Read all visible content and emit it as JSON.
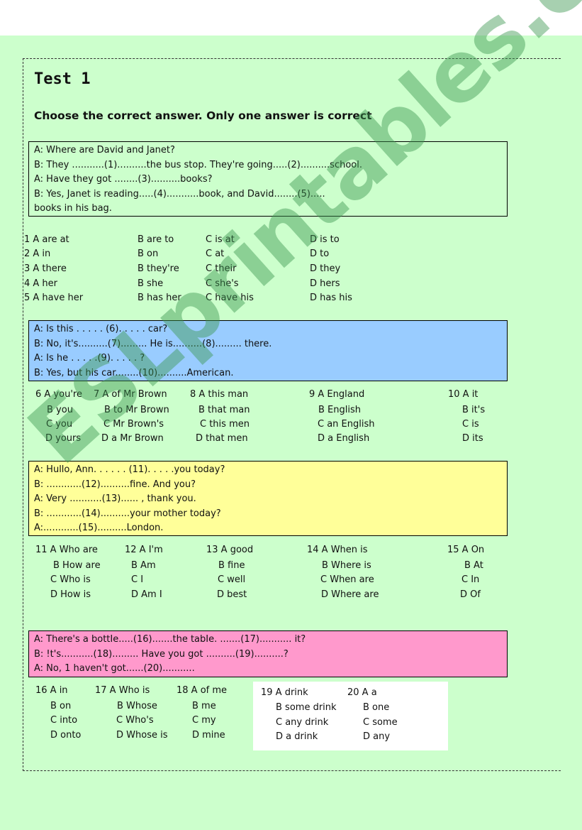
{
  "title": "Test 1",
  "instruction": "Choose the correct answer. Only one answer is correct",
  "watermark": "ESLprintables.com",
  "colors": {
    "page_background": "#ccffcc",
    "dialog1_background": "#ccffcc",
    "dialog2_background": "#99ccff",
    "dialog3_background": "#ffff99",
    "dialog4_background": "#ff99cc"
  },
  "dialogs": [
    {
      "lines": [
        "A: Where are David and Janet?",
        "B: They ...........(1)..........the bus stop. They're going.....(2)..........school.",
        "A: Have they got ........(3)..........books?",
        "B: Yes, Janet is reading.....(4)...........book, and David........(5).....",
        "books in his bag."
      ]
    },
    {
      "lines": [
        "A: Is this . . . . . (6). . . . . car?",
        "B: No, it's..........(7)......... He is..........(8)......... there.",
        "A: Is he . . . . .(9). . . . . ?",
        "B: Yes, but his car........(10)..........American."
      ]
    },
    {
      "lines": [
        "A: Hullo, Ann. . . . . . (11). . . . .you today?",
        "B: ............(12)..........fine. And you?",
        "A: Very ...........(13)...... , thank you.",
        "B: ............(14)..........your mother today?",
        "A:............(15)..........London."
      ]
    },
    {
      "lines": [
        "A: There's a bottIe.....(16).......the tabIe. .......(17)........... it?",
        "B: !t's...........(18)......... Have you got ..........(19)..........?",
        "A: No, 1 haven't got......(20)..........."
      ]
    }
  ],
  "questions_1_5": [
    [
      "1 A are at",
      "B are to",
      "C is at",
      "D is to"
    ],
    [
      "2 A in",
      "B on",
      "C at",
      "D to"
    ],
    [
      "3 A there",
      "B they're",
      "C their",
      "D they"
    ],
    [
      "4 A her",
      "B she",
      "C she's",
      "D hers"
    ],
    [
      "5 A have her",
      "B has her",
      "C have his",
      "D has his"
    ]
  ],
  "questions_6_10": [
    [
      "6  A you're",
      "B you",
      "C you",
      "D yours"
    ],
    [
      "7 A of Mr Brown",
      "B to Mr Brown",
      "C Mr Brown's",
      "D a Mr Brown"
    ],
    [
      "8 A this man",
      "B that man",
      "C this men",
      "D that men"
    ],
    [
      "9 A England",
      "B English",
      "C an English",
      "D  a English"
    ],
    [
      "10 A it",
      "B it's",
      "C is",
      "D its"
    ]
  ],
  "questions_11_15": [
    [
      "11 A Who are",
      "B How are",
      "C Who is",
      "D How is"
    ],
    [
      "12 A I'm",
      "B Am",
      "C I",
      "D Am I"
    ],
    [
      "13 A good",
      "B fine",
      "C well",
      "D best"
    ],
    [
      "14 A When is",
      "B Where is",
      "C When are",
      "D Where are"
    ],
    [
      "15 A On",
      "B At",
      "C In",
      "D Of"
    ]
  ],
  "questions_16_20": [
    [
      "16  A in",
      "B on",
      "C into",
      "D onto"
    ],
    [
      "17 A Who is",
      "B Whose",
      "C Who's",
      "D Whose is"
    ],
    [
      "18 A of me",
      "B me",
      "C my",
      "D mine"
    ],
    [
      "19 A drink",
      "B some drink",
      "C any drink",
      "D a drink"
    ],
    [
      "20 A a",
      "B one",
      "C some",
      "D any"
    ]
  ]
}
